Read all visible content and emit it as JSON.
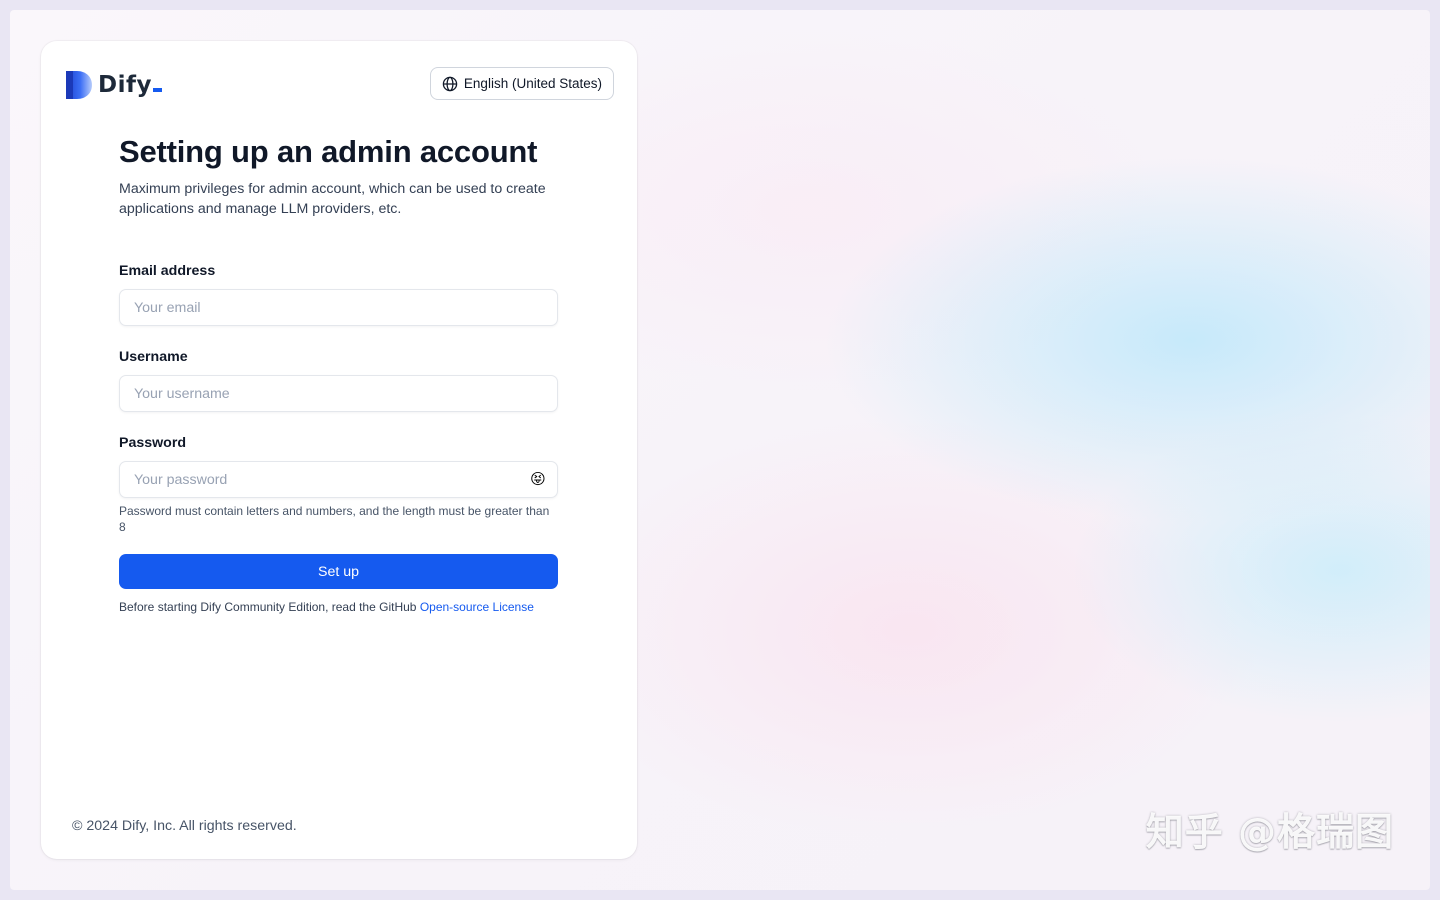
{
  "brand": {
    "name": "Dify",
    "accent_color": "#155aef",
    "logo_icon": "dify-logo-icon"
  },
  "language": {
    "icon": "globe-icon",
    "selected": "English (United States)"
  },
  "form": {
    "title": "Setting up an admin account",
    "subtitle": "Maximum privileges for admin account, which can be used to create applications and manage LLM providers, etc.",
    "email": {
      "label": "Email address",
      "placeholder": "Your email",
      "value": ""
    },
    "username": {
      "label": "Username",
      "placeholder": "Your username",
      "value": ""
    },
    "password": {
      "label": "Password",
      "placeholder": "Your password",
      "value": "",
      "toggle_icon": "😝",
      "hint": "Password must contain letters and numbers, and the length must be greater than 8"
    },
    "submit_label": "Set up",
    "license_prefix": "Before starting Dify Community Edition, read the GitHub",
    "license_link": "Open-source License"
  },
  "footer": {
    "copyright": "© 2024 Dify, Inc. All rights reserved."
  },
  "watermark": {
    "text": "知乎 @格瑞图"
  }
}
